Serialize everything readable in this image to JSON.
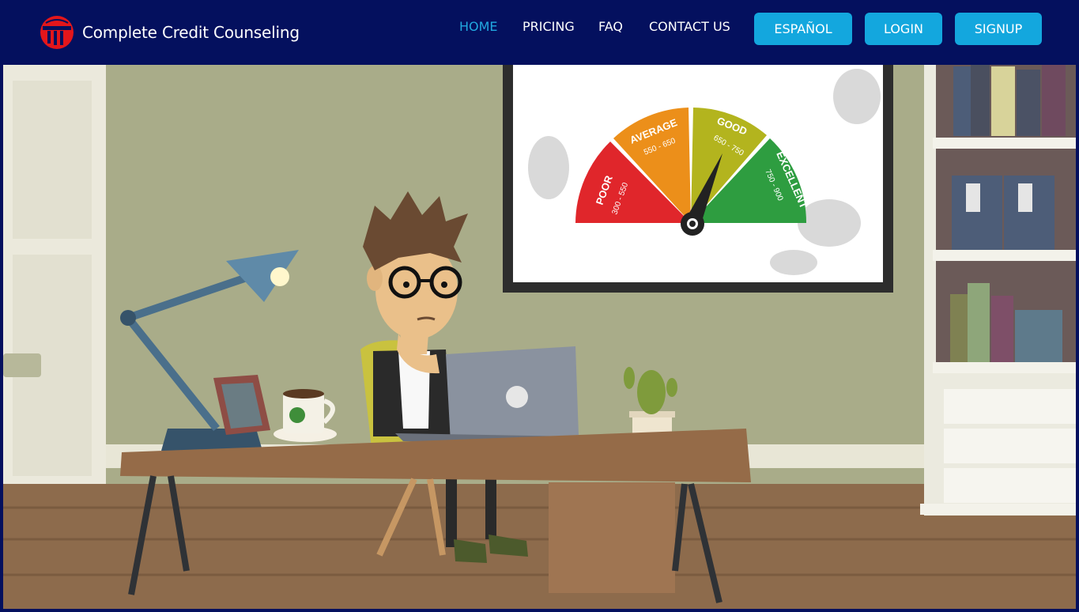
{
  "brand": {
    "name": "Complete Credit Counseling",
    "logo_icon": "credit-counseling-logo-icon",
    "accent_color": "#e3161b"
  },
  "nav": {
    "links": [
      {
        "label": "HOME",
        "active": true
      },
      {
        "label": "PRICING",
        "active": false
      },
      {
        "label": "FAQ",
        "active": false
      },
      {
        "label": "CONTACT US",
        "active": false
      }
    ],
    "buttons": [
      {
        "label": "ESPAÑOL"
      },
      {
        "label": "LOGIN"
      },
      {
        "label": "SIGNUP"
      }
    ],
    "background_color": "#04105e",
    "button_color": "#13a7de",
    "active_color": "#21a8e0"
  },
  "hero": {
    "gauge": {
      "segments": [
        {
          "label": "POOR",
          "range": "300 - 550",
          "color": "#e0262b"
        },
        {
          "label": "AVERAGE",
          "range": "550 - 650",
          "color": "#ec8f1a"
        },
        {
          "label": "GOOD",
          "range": "650 - 750",
          "color": "#b3b41e"
        },
        {
          "label": "EXCELLENT",
          "range": "750 - 900",
          "color": "#2e9d40"
        }
      ]
    }
  }
}
